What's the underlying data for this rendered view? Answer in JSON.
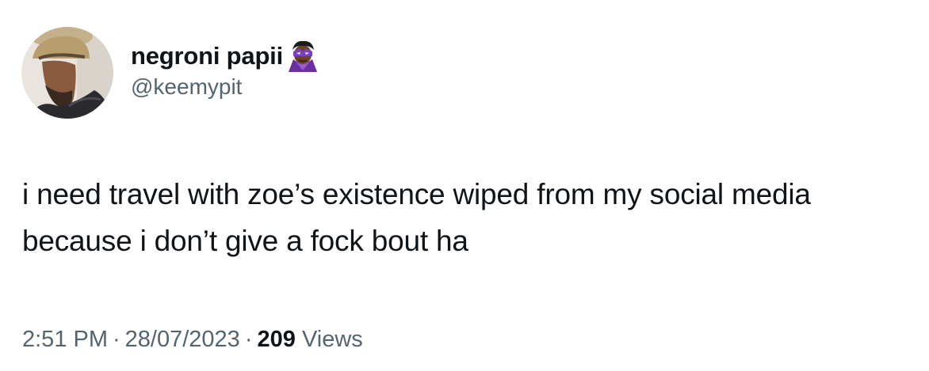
{
  "user": {
    "display_name": "negroni papii",
    "handle": "@keemypit",
    "avatar_icon": "profile-photo",
    "badge_emoji": "supervillain-emoji"
  },
  "tweet": {
    "text": "i need travel with zoe’s existence wiped from my social media because i don’t give a fock bout ha",
    "time": "2:51 PM",
    "separator": "·",
    "date": "28/07/2023",
    "views_count": "209",
    "views_label": "Views"
  },
  "colors": {
    "text_primary": "#0f1419",
    "text_secondary": "#536471",
    "background": "#ffffff"
  }
}
